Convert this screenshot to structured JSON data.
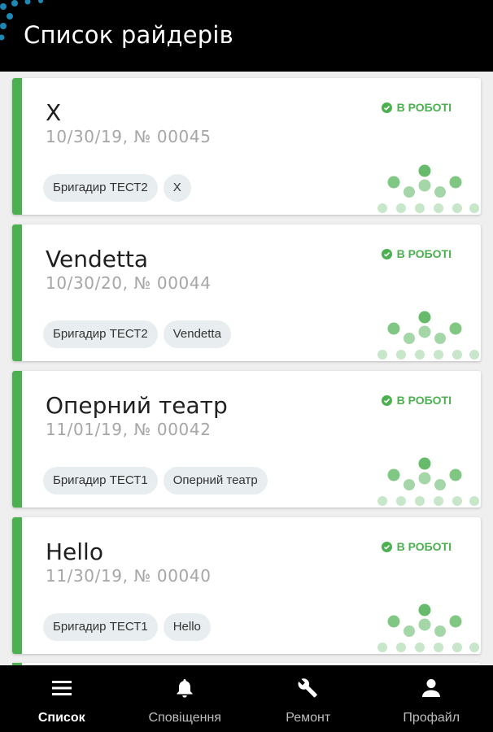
{
  "header": {
    "title": "Список райдерів"
  },
  "cards": [
    {
      "name": "X",
      "meta": "10/30/19, № 00045",
      "status": "В РОБОТІ",
      "tags": [
        "Бригадир ТЕСТ2",
        "X"
      ]
    },
    {
      "name": "Vendetta",
      "meta": "10/30/20, № 00044",
      "status": "В РОБОТІ",
      "tags": [
        "Бригадир ТЕСТ2",
        "Vendetta"
      ]
    },
    {
      "name": "Оперний театр",
      "meta": "11/01/19, № 00042",
      "status": "В РОБОТІ",
      "tags": [
        "Бригадир ТЕСТ1",
        "Оперний театр"
      ]
    },
    {
      "name": "Hello",
      "meta": "11/30/19, № 00040",
      "status": "В РОБОТІ",
      "tags": [
        "Бригадир ТЕСТ1",
        "Hello"
      ]
    }
  ],
  "nav": [
    {
      "label": "Список",
      "icon": "menu-icon",
      "active": true
    },
    {
      "label": "Сповіщення",
      "icon": "bell-icon",
      "active": false
    },
    {
      "label": "Ремонт",
      "icon": "wrench-icon",
      "active": false
    },
    {
      "label": "Профайл",
      "icon": "person-icon",
      "active": false
    }
  ],
  "colors": {
    "accent": "#4caf50",
    "header_bg": "#000000",
    "logo": "#1e88b4"
  }
}
